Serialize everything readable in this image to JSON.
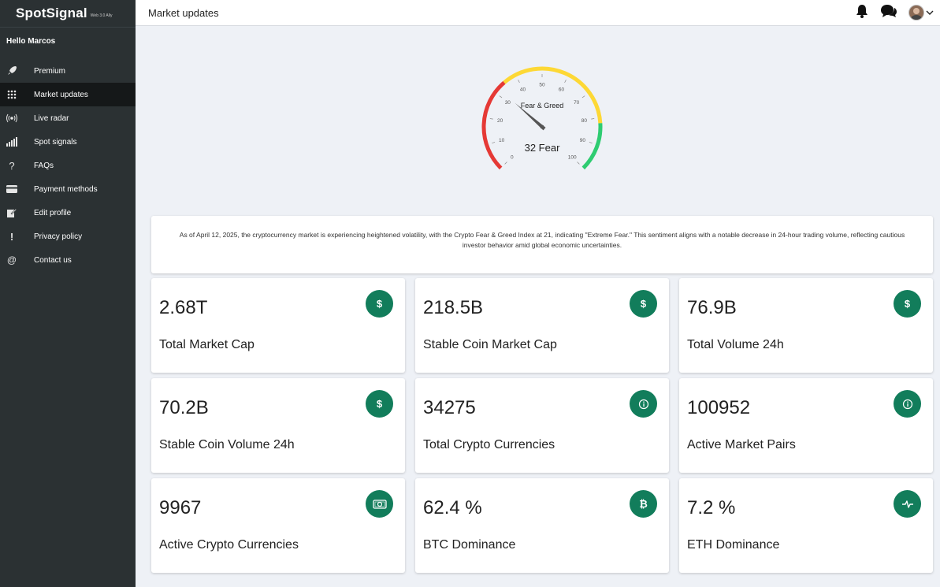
{
  "brand": {
    "name": "SpotSignal",
    "sub": "Web 3.0 Ally"
  },
  "greeting": "Hello Marcos",
  "sidebar": {
    "items": [
      {
        "label": "Premium",
        "icon": "rocket-icon"
      },
      {
        "label": "Market updates",
        "icon": "grid-icon",
        "active": true
      },
      {
        "label": "Live radar",
        "icon": "radar-icon"
      },
      {
        "label": "Spot signals",
        "icon": "signal-bars-icon"
      },
      {
        "label": "FAQs",
        "icon": "question-icon"
      },
      {
        "label": "Payment methods",
        "icon": "card-icon"
      },
      {
        "label": "Edit profile",
        "icon": "edit-icon"
      },
      {
        "label": "Privacy policy",
        "icon": "exclamation-icon"
      },
      {
        "label": "Contact us",
        "icon": "at-icon"
      }
    ]
  },
  "header": {
    "title": "Market updates"
  },
  "gauge": {
    "title": "Fear & Greed",
    "value": 32,
    "readout": "32 Fear",
    "ticks": [
      "0",
      "10",
      "20",
      "30",
      "40",
      "50",
      "60",
      "70",
      "80",
      "90",
      "100"
    ],
    "colors": {
      "fear": "#e53935",
      "neutral": "#fdd835",
      "greed": "#2ecc71"
    }
  },
  "description": "As of April 12, 2025, the cryptocurrency market is experiencing heightened volatility, with the Crypto Fear & Greed Index at 21, indicating \"Extreme Fear.\" This sentiment aligns with a notable decrease in 24-hour trading volume, reflecting cautious investor behavior amid global economic uncertainties.",
  "cards": [
    {
      "value": "2.68T",
      "label": "Total Market Cap",
      "icon": "dollar-icon"
    },
    {
      "value": "218.5B",
      "label": "Stable Coin Market Cap",
      "icon": "dollar-icon"
    },
    {
      "value": "76.9B",
      "label": "Total Volume 24h",
      "icon": "dollar-icon"
    },
    {
      "value": "70.2B",
      "label": "Stable Coin Volume 24h",
      "icon": "dollar-icon"
    },
    {
      "value": "34275",
      "label": "Total Crypto Currencies",
      "icon": "info-icon"
    },
    {
      "value": "100952",
      "label": "Active Market Pairs",
      "icon": "info-icon"
    },
    {
      "value": "9967",
      "label": "Active Crypto Currencies",
      "icon": "money-icon"
    },
    {
      "value": "62.4 %",
      "label": "BTC Dominance",
      "icon": "bitcoin-icon"
    },
    {
      "value": "7.2 %",
      "label": "ETH Dominance",
      "icon": "pulse-icon"
    }
  ],
  "accent": "#127d5b"
}
